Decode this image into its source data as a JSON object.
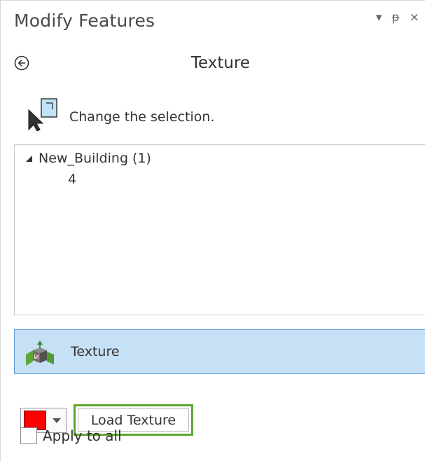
{
  "pane": {
    "title": "Modify Features",
    "controls": {
      "menu_glyph": "▾",
      "pin_glyph": "ᵽ",
      "close_glyph": "×"
    },
    "subtitle": "Texture"
  },
  "icons": {
    "back": "back-circle-arrow-icon",
    "selection": "change-selection-icon",
    "texture_tool": "texture-cube-icon",
    "expand": "expanded-triangle-icon"
  },
  "selection": {
    "label": "Change the selection."
  },
  "tree": {
    "node_label": "New_Building (1)",
    "children": [
      "4"
    ]
  },
  "tool": {
    "label": "Texture"
  },
  "texture_options": {
    "color": "#ff0000",
    "load_label": "Load Texture",
    "apply_all_label": "Apply to all",
    "apply_all_checked": false
  },
  "colors": {
    "tool_highlight": "#c6e0f6",
    "tool_border": "#5e9ed6",
    "load_highlight": "#5ea52f"
  }
}
